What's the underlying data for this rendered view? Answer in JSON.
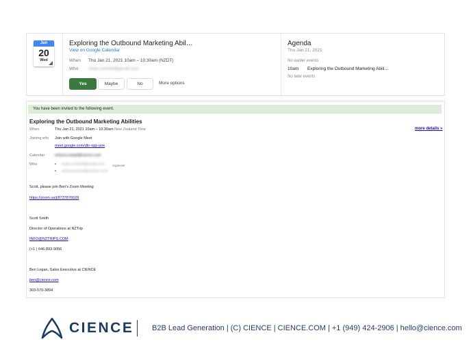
{
  "invite": {
    "calendar_icon": {
      "month": "Jan",
      "day": "20",
      "weekday": "Wed",
      "accent": "#4285f4"
    },
    "title": "Exploring the Outbound Marketing Abil…",
    "view_link": "View on Google Calendar",
    "when_label": "When",
    "when_value": "Thu Jan 21, 2021 10am – 10:30am (NZDT)",
    "who_label": "Who",
    "who_value": "kotas.remehf@gmail.com",
    "rsvp": {
      "yes": "Yes",
      "maybe": "Maybe",
      "no": "No",
      "more": "More options",
      "yes_color": "#3b7a3e"
    }
  },
  "agenda": {
    "title": "Agenda",
    "date": "Thu Jan 21, 2021",
    "no_earlier": "No earlier events",
    "event_time": "10am",
    "event_title": "Exploring the Outbound Marketing Abili…",
    "no_later": "No later events"
  },
  "email": {
    "banner": "You have been invited to the following event.",
    "banner_color": "#dcedd9",
    "title": "Exploring the Outbound Marketing Abilities",
    "more_details": "more details »",
    "when_label": "When",
    "when_value": "Thu Jan 21, 2021 10am – 10:30am",
    "when_tz": "New Zealand Time",
    "joining_label": "Joining info",
    "joining_value": "Join with Google Meet",
    "meet_link": "meet.google.com/dkr-npp-pok",
    "calendar_label": "Calendar",
    "calendar_value": "selsess.kslaaf@cience.com",
    "who_label": "Who",
    "guests": [
      {
        "email": "kotas.remehf@bmail.com",
        "role": "organizer"
      },
      {
        "email": "selsess.kslaaf@cience.com",
        "role": ""
      }
    ],
    "body": {
      "intro": "Scott, please join Ben's Zoom Meeting",
      "zoom_link": "https://zoom.us/j/8737876628",
      "sig_name": "Scott Smith",
      "sig_title": "Director of Operations at NZTrip",
      "sig_email": "INFO@NZTRIPS.COM",
      "sig_phone": "(+1 ) 646-893-9056",
      "ben_line": "Ben Logan, Sales Executive at CIENCE",
      "ben_email": "ben@cience.com",
      "ben_phone": "303-570-3894"
    }
  },
  "footer": {
    "logo_text": "CIENCE",
    "tagline": "B2B Lead Generation | (C) CIENCE | CIENCE.COM | +1 (949) 424-2906 | hello@cience.com",
    "brand_color": "#1f3a5f"
  }
}
